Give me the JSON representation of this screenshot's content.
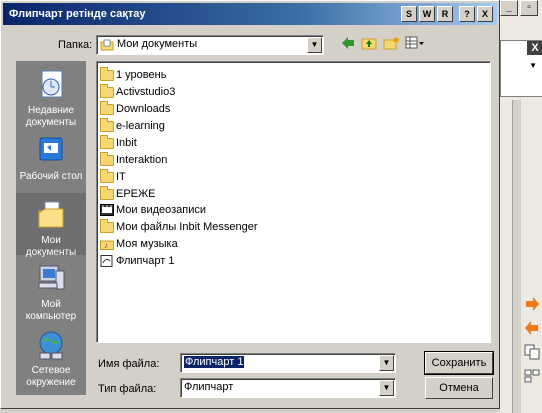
{
  "window": {
    "title": "Флипчарт ретінде сақтау"
  },
  "title_buttons": [
    "S",
    "W",
    "R",
    "?",
    "X"
  ],
  "lookin": {
    "label": "Папка:",
    "value": "Мои документы"
  },
  "places": [
    {
      "label": "Недавние документы",
      "icon": "recent-documents-icon"
    },
    {
      "label": "Рабочий стол",
      "icon": "desktop-icon"
    },
    {
      "label": "Мои документы",
      "icon": "my-documents-icon"
    },
    {
      "label": "Мой компьютер",
      "icon": "my-computer-icon"
    },
    {
      "label": "Сетевое окружение",
      "icon": "network-icon"
    }
  ],
  "files": [
    {
      "name": "1 уровень",
      "icon": "folder-icon"
    },
    {
      "name": "Activstudio3",
      "icon": "folder-icon"
    },
    {
      "name": "Downloads",
      "icon": "folder-icon"
    },
    {
      "name": "e-learning",
      "icon": "folder-icon"
    },
    {
      "name": "Inbit",
      "icon": "folder-icon"
    },
    {
      "name": "Interaktion",
      "icon": "folder-icon"
    },
    {
      "name": "IT",
      "icon": "folder-icon"
    },
    {
      "name": "ЕРЕЖЕ",
      "icon": "folder-icon"
    },
    {
      "name": "Мои видеозаписи",
      "icon": "video-folder-icon"
    },
    {
      "name": "Мои файлы Inbit Messenger",
      "icon": "folder-icon"
    },
    {
      "name": "Моя музыка",
      "icon": "music-folder-icon"
    },
    {
      "name": "Флипчарт 1",
      "icon": "flipchart-file-icon"
    }
  ],
  "filename": {
    "label": "Имя файла:",
    "value": "Флипчарт 1"
  },
  "filetype": {
    "label": "Тип файла:",
    "value": "Флипчарт"
  },
  "buttons": {
    "save": "Сохранить",
    "cancel": "Отмена"
  },
  "background_window": {
    "close": "X"
  }
}
